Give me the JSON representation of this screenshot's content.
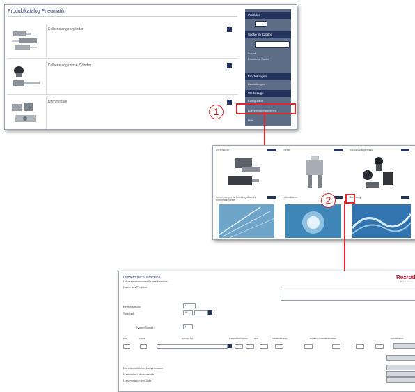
{
  "colors": {
    "brand": "#23345f",
    "sidebar": "#5e6d86",
    "marker": "#e2262a",
    "logo": "#c8102e"
  },
  "step1": {
    "title": "Produktkatalog Pneumatik",
    "products": [
      {
        "label": "Kolbenstangenzylinder",
        "icon": "piston-rod-cylinder-image"
      },
      {
        "label": "Kolbenstangenlose Zylinder",
        "icon": "rodless-cylinder-image"
      },
      {
        "label": "Drehmodule",
        "icon": "rotary-module-image"
      }
    ],
    "sidebar": {
      "sections": [
        {
          "header": "Produkte",
          "items": []
        },
        {
          "header": "Suche im Katalog",
          "items": [
            "Suche",
            "Erweiterte Suche"
          ]
        },
        {
          "header": "Einstellungen",
          "items": [
            "Einstellungen"
          ]
        },
        {
          "header": "Werkzeuge",
          "items": [
            "Konfigurator",
            "Luftverbrauchsrechner",
            "Hilfe"
          ]
        }
      ]
    },
    "marker": "1"
  },
  "step2": {
    "tiles": [
      {
        "label": "Greifmodule",
        "icon": "gripper-module-image"
      },
      {
        "label": "Greifer",
        "icon": "gripper-image"
      },
      {
        "label": "Vakuum-Saugtechnik",
        "icon": "vacuum-components-image"
      },
      {
        "label": "Berechnungen für Antriebsgrößen für Pneumatikzylinder",
        "icon": "blue-calculation-image"
      },
      {
        "label": "Luftverbrauch",
        "icon": "blue-globe-image"
      },
      {
        "label": "Dämpfung",
        "icon": "blue-wave-image"
      }
    ],
    "marker": "2"
  },
  "step3": {
    "title": "Luftverbrauch Maschine",
    "subtitle": "Luftverbrauchsrechner für eine Maschine",
    "logo": "Rexroth",
    "logo_sub": "Bosch Group",
    "project_label": "Name des Projekts:",
    "fields": [
      {
        "label": "Betriebsdruck:",
        "value": "6"
      },
      {
        "label": "Spielzeit:",
        "value": "10"
      },
      {
        "label": "Zyklen/Stunde:",
        "value": "1"
      }
    ],
    "table_headers": [
      "Pos.",
      "Anzahl",
      "Zylinder Typ",
      "Kolbendurchmesser",
      "Hub",
      "Schlauch-Länge",
      "Schlauch-Innendurchmesser",
      "Luftverbrauch"
    ],
    "result_labels": [
      "Durchschnittlicher Luftverbrauch",
      "Maximaler Luftverbrauch",
      "Luftverbrauch pro Jahr"
    ],
    "result_unit": "Nl"
  }
}
